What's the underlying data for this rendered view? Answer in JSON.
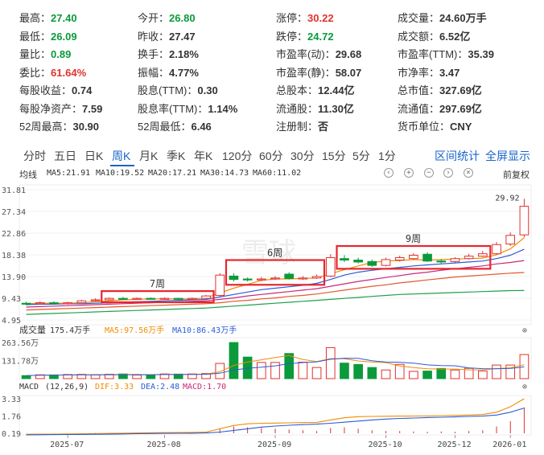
{
  "quote": {
    "rows": [
      [
        {
          "label": "最高",
          "value": "27.40",
          "color": "green"
        },
        {
          "label": "今开",
          "value": "26.80",
          "color": "green"
        },
        {
          "label": "涨停",
          "value": "30.22",
          "color": "red"
        },
        {
          "label": "成交量",
          "value": "24.60万手",
          "color": "dark"
        }
      ],
      [
        {
          "label": "最低",
          "value": "26.09",
          "color": "green"
        },
        {
          "label": "昨收",
          "value": "27.47",
          "color": "dark"
        },
        {
          "label": "跌停",
          "value": "24.72",
          "color": "green"
        },
        {
          "label": "成交额",
          "value": "6.52亿",
          "color": "dark"
        }
      ],
      [
        {
          "label": "量比",
          "value": "0.89",
          "color": "green"
        },
        {
          "label": "换手",
          "value": "2.18%",
          "color": "dark"
        },
        {
          "label": "市盈率(动)",
          "value": "29.68",
          "color": "dark"
        },
        {
          "label": "市盈率(TTM)",
          "value": "35.39",
          "color": "dark"
        }
      ],
      [
        {
          "label": "委比",
          "value": "61.64%",
          "color": "red"
        },
        {
          "label": "振幅",
          "value": "4.77%",
          "color": "dark"
        },
        {
          "label": "市盈率(静)",
          "value": "58.07",
          "color": "dark"
        },
        {
          "label": "市净率",
          "value": "3.47",
          "color": "dark"
        }
      ],
      [
        {
          "label": "每股收益",
          "value": "0.74",
          "color": "dark"
        },
        {
          "label": "股息(TTM)",
          "value": "0.30",
          "color": "dark"
        },
        {
          "label": "总股本",
          "value": "12.44亿",
          "color": "dark"
        },
        {
          "label": "总市值",
          "value": "327.69亿",
          "color": "dark"
        }
      ],
      [
        {
          "label": "每股净资产",
          "value": "7.59",
          "color": "dark"
        },
        {
          "label": "股息率(TTM)",
          "value": "1.14%",
          "color": "dark"
        },
        {
          "label": "流通股",
          "value": "11.30亿",
          "color": "dark"
        },
        {
          "label": "流通值",
          "value": "297.69亿",
          "color": "dark"
        }
      ],
      [
        {
          "label": "52周最高",
          "value": "30.90",
          "color": "dark"
        },
        {
          "label": "52周最低",
          "value": "6.46",
          "color": "dark"
        },
        {
          "label": "注册制",
          "value": "否",
          "color": "dark"
        },
        {
          "label": "货币单位",
          "value": "CNY",
          "color": "dark"
        }
      ]
    ]
  },
  "tabs": {
    "items": [
      "分时",
      "五日",
      "日K",
      "周K",
      "月K",
      "季K",
      "年K",
      "120分",
      "60分",
      "30分",
      "15分",
      "5分",
      "1分"
    ],
    "active": "周K",
    "interval_stats": "区间统计",
    "fullscreen": "全屏显示"
  },
  "kline": {
    "title": "均线",
    "ma": [
      {
        "label": "MA5:21.91",
        "color": "#f08c00"
      },
      {
        "label": "MA10:19.52",
        "color": "#2a5bd7"
      },
      {
        "label": "MA20:17.21",
        "color": "#c8287a"
      },
      {
        "label": "MA30:14.73",
        "color": "#e05a2b"
      },
      {
        "label": "MA60:11.02",
        "color": "#1fa04a"
      }
    ],
    "controls": [
      "‹",
      "+",
      "−",
      "›",
      "×"
    ],
    "fuquan": "前复权",
    "y_ticks": [
      "31.81",
      "27.34",
      "22.86",
      "18.38",
      "13.90",
      "9.43",
      "4.95"
    ],
    "peak_label": "29.92",
    "annotations": [
      {
        "text": "7周"
      },
      {
        "text": "6周"
      },
      {
        "text": "9周"
      }
    ],
    "watermark": "雪球"
  },
  "volume": {
    "title": "成交量",
    "current": "175.4万手",
    "ma5": "MA5:97.56万手",
    "ma10": "MA10:86.43万手",
    "y_ticks": [
      "263.56万",
      "131.78万"
    ]
  },
  "macd": {
    "title": "MACD",
    "params": "(12,26,9)",
    "dif": "DIF:3.33",
    "dea": "DEA:2.48",
    "macd": "MACD:1.70",
    "y_ticks": [
      "3.33",
      "1.76",
      "0.19"
    ]
  },
  "x_axis": [
    "2025-07",
    "2025-08",
    "2025-09",
    "2025-10",
    "2025-12",
    "2026-01"
  ],
  "colors": {
    "up": "#e0322d",
    "down": "#0a9a3b",
    "accent": "#1a64c8",
    "box": "#e8262d"
  },
  "chart_data": {
    "type": "candlestick",
    "price_axis": [
      4.95,
      31.81
    ],
    "candles": [
      {
        "o": 8.4,
        "c": 8.3,
        "h": 8.7,
        "l": 8.0
      },
      {
        "o": 8.3,
        "c": 8.5,
        "h": 8.8,
        "l": 8.1
      },
      {
        "o": 8.5,
        "c": 8.3,
        "h": 8.8,
        "l": 8.1
      },
      {
        "o": 8.3,
        "c": 8.5,
        "h": 8.7,
        "l": 8.1
      },
      {
        "o": 8.5,
        "c": 8.9,
        "h": 9.1,
        "l": 8.4
      },
      {
        "o": 8.9,
        "c": 9.1,
        "h": 9.4,
        "l": 8.8
      },
      {
        "o": 9.1,
        "c": 9.4,
        "h": 9.6,
        "l": 9.0
      },
      {
        "o": 9.4,
        "c": 9.2,
        "h": 9.7,
        "l": 9.1
      },
      {
        "o": 9.2,
        "c": 9.4,
        "h": 9.6,
        "l": 9.1
      },
      {
        "o": 9.4,
        "c": 9.3,
        "h": 9.6,
        "l": 9.2
      },
      {
        "o": 9.3,
        "c": 9.4,
        "h": 9.6,
        "l": 9.2
      },
      {
        "o": 9.4,
        "c": 9.3,
        "h": 9.5,
        "l": 9.2
      },
      {
        "o": 9.3,
        "c": 9.4,
        "h": 9.6,
        "l": 9.2
      },
      {
        "o": 9.4,
        "c": 9.9,
        "h": 10.1,
        "l": 9.3
      },
      {
        "o": 10.0,
        "c": 14.2,
        "h": 14.6,
        "l": 9.8
      },
      {
        "o": 14.0,
        "c": 13.3,
        "h": 14.6,
        "l": 12.9
      },
      {
        "o": 13.4,
        "c": 13.2,
        "h": 13.7,
        "l": 12.9
      },
      {
        "o": 13.2,
        "c": 13.4,
        "h": 13.8,
        "l": 13.0
      },
      {
        "o": 13.4,
        "c": 13.6,
        "h": 14.0,
        "l": 13.2
      },
      {
        "o": 14.4,
        "c": 13.5,
        "h": 14.8,
        "l": 13.3
      },
      {
        "o": 13.4,
        "c": 13.6,
        "h": 14.0,
        "l": 13.2
      },
      {
        "o": 13.6,
        "c": 13.9,
        "h": 14.3,
        "l": 13.4
      },
      {
        "o": 14.0,
        "c": 17.8,
        "h": 18.5,
        "l": 13.8
      },
      {
        "o": 17.6,
        "c": 17.3,
        "h": 18.3,
        "l": 16.9
      },
      {
        "o": 17.3,
        "c": 16.9,
        "h": 17.8,
        "l": 16.6
      },
      {
        "o": 17.0,
        "c": 16.2,
        "h": 17.4,
        "l": 15.9
      },
      {
        "o": 16.2,
        "c": 17.4,
        "h": 17.8,
        "l": 16.0
      },
      {
        "o": 17.3,
        "c": 17.8,
        "h": 18.2,
        "l": 17.0
      },
      {
        "o": 17.6,
        "c": 18.3,
        "h": 18.7,
        "l": 17.4
      },
      {
        "o": 18.5,
        "c": 17.1,
        "h": 18.9,
        "l": 16.9
      },
      {
        "o": 17.1,
        "c": 17.0,
        "h": 17.5,
        "l": 16.6
      },
      {
        "o": 17.0,
        "c": 17.6,
        "h": 17.9,
        "l": 16.8
      },
      {
        "o": 17.6,
        "c": 18.1,
        "h": 18.6,
        "l": 17.4
      },
      {
        "o": 18.1,
        "c": 18.6,
        "h": 19.2,
        "l": 17.9
      },
      {
        "o": 18.6,
        "c": 20.5,
        "h": 21.0,
        "l": 18.4
      },
      {
        "o": 20.6,
        "c": 22.4,
        "h": 23.0,
        "l": 20.2
      },
      {
        "o": 22.5,
        "c": 28.4,
        "h": 29.92,
        "l": 22.0
      }
    ],
    "volume": [
      22,
      28,
      27,
      30,
      31,
      27,
      32,
      34,
      26,
      27,
      34,
      33,
      34,
      37,
      111,
      263,
      157,
      118,
      118,
      183,
      120,
      81,
      226,
      113,
      103,
      81,
      63,
      104,
      53,
      55,
      74,
      63,
      75,
      56,
      99,
      99,
      175.4
    ],
    "macd_hist": [
      0.01,
      0.01,
      0.01,
      0.01,
      0.01,
      0.02,
      0.02,
      0.01,
      0.01,
      0.01,
      0.01,
      0.01,
      0.01,
      0.02,
      0.3,
      0.45,
      0.4,
      0.35,
      0.3,
      0.25,
      0.2,
      0.15,
      0.35,
      0.4,
      0.3,
      0.2,
      0.15,
      0.15,
      0.12,
      0.1,
      0.12,
      0.1,
      0.15,
      0.2,
      0.45,
      0.8,
      1.7
    ],
    "series": [
      {
        "name": "MA5",
        "values": [
          8.3,
          8.4,
          8.4,
          8.4,
          8.5,
          8.7,
          8.9,
          9.1,
          9.2,
          9.3,
          9.3,
          9.3,
          9.3,
          9.5,
          10.5,
          11.5,
          12.3,
          13.1,
          13.4,
          13.4,
          13.5,
          13.6,
          14.5,
          15.3,
          16.1,
          16.8,
          17.1,
          17.2,
          17.4,
          17.3,
          17.4,
          17.5,
          17.6,
          17.7,
          18.4,
          19.6,
          21.91
        ]
      },
      {
        "name": "MA10",
        "values": [
          8.1,
          8.2,
          8.2,
          8.3,
          8.3,
          8.4,
          8.5,
          8.6,
          8.7,
          8.8,
          8.9,
          9.0,
          9.1,
          9.2,
          9.7,
          10.2,
          10.7,
          11.2,
          11.5,
          11.8,
          12.1,
          12.5,
          13.3,
          14.2,
          14.8,
          15.2,
          15.5,
          15.8,
          16.1,
          16.3,
          16.5,
          16.7,
          16.9,
          17.1,
          17.6,
          18.3,
          19.52
        ]
      },
      {
        "name": "MA20",
        "values": [
          7.6,
          7.7,
          7.8,
          7.9,
          8.0,
          8.1,
          8.2,
          8.3,
          8.4,
          8.5,
          8.6,
          8.7,
          8.8,
          8.9,
          9.2,
          9.5,
          9.9,
          10.2,
          10.5,
          10.8,
          11.1,
          11.4,
          11.9,
          12.4,
          12.9,
          13.3,
          13.7,
          14.1,
          14.5,
          14.8,
          15.2,
          15.5,
          15.8,
          16.1,
          16.5,
          16.8,
          17.21
        ]
      },
      {
        "name": "MA30",
        "values": [
          7.0,
          7.1,
          7.2,
          7.3,
          7.4,
          7.5,
          7.6,
          7.7,
          7.8,
          7.9,
          8.0,
          8.1,
          8.2,
          8.3,
          8.5,
          8.8,
          9.0,
          9.3,
          9.5,
          9.8,
          10.0,
          10.3,
          10.7,
          11.1,
          11.5,
          11.9,
          12.2,
          12.6,
          12.9,
          13.2,
          13.5,
          13.8,
          14.0,
          14.2,
          14.4,
          14.6,
          14.73
        ]
      },
      {
        "name": "MA60",
        "values": [
          6.1,
          6.2,
          6.3,
          6.4,
          6.5,
          6.6,
          6.7,
          6.8,
          6.9,
          7.0,
          7.1,
          7.2,
          7.3,
          7.4,
          7.6,
          7.8,
          8.0,
          8.2,
          8.4,
          8.6,
          8.8,
          9.0,
          9.2,
          9.4,
          9.6,
          9.8,
          10.0,
          10.2,
          10.3,
          10.4,
          10.5,
          10.6,
          10.7,
          10.8,
          10.9,
          11.0,
          11.02
        ]
      },
      {
        "name": "DIF",
        "values": [
          0.1,
          0.11,
          0.12,
          0.13,
          0.14,
          0.16,
          0.18,
          0.2,
          0.22,
          0.24,
          0.25,
          0.26,
          0.27,
          0.3,
          0.6,
          0.9,
          1.05,
          1.1,
          1.12,
          1.14,
          1.16,
          1.18,
          1.4,
          1.6,
          1.7,
          1.72,
          1.74,
          1.75,
          1.76,
          1.77,
          1.8,
          1.82,
          1.85,
          1.9,
          2.1,
          2.6,
          3.33
        ]
      },
      {
        "name": "DEA",
        "values": [
          0.05,
          0.06,
          0.07,
          0.08,
          0.09,
          0.1,
          0.11,
          0.13,
          0.15,
          0.17,
          0.18,
          0.19,
          0.2,
          0.22,
          0.3,
          0.45,
          0.6,
          0.75,
          0.85,
          0.92,
          0.98,
          1.02,
          1.1,
          1.2,
          1.3,
          1.4,
          1.48,
          1.54,
          1.58,
          1.62,
          1.65,
          1.68,
          1.72,
          1.75,
          1.85,
          2.1,
          2.48
        ]
      }
    ]
  }
}
